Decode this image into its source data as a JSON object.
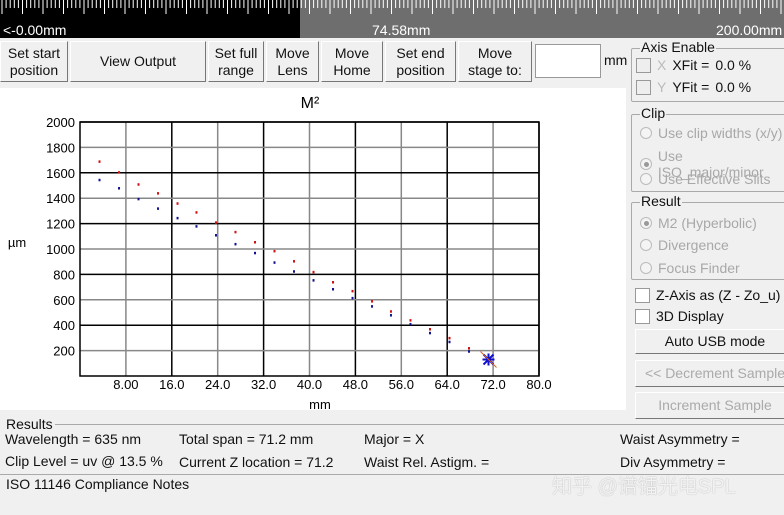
{
  "ruler": {
    "left": "<-0.00mm",
    "current": "74.58mm",
    "right": "200.00mm"
  },
  "toolbar": {
    "set_start": "Set start position",
    "view_output": "View Output",
    "set_full": "Set full range",
    "move_lens": "Move Lens",
    "move_home": "Move Home",
    "set_end": "Set end position",
    "move_stage": "Move stage to:",
    "stage_value": "",
    "unit": "mm"
  },
  "axis_enable": {
    "title": "Axis Enable",
    "x_label": "X",
    "xfit_label": "XFit =",
    "xfit": "0.0 %",
    "y_label": "Y",
    "yfit_label": "YFit =",
    "yfit": "0.0 %"
  },
  "clip": {
    "title": "Clip",
    "options": [
      "Use clip widths (x/y)",
      "Use ISO_major/minor",
      "Use Effective Slits"
    ],
    "selected": 1
  },
  "result": {
    "title": "Result",
    "options": [
      "M2 (Hyperbolic)",
      "Divergence",
      "Focus Finder"
    ],
    "selected": 0
  },
  "checks": {
    "zaxis": "Z-Axis as (Z - Zo_u)",
    "display3d": "3D Display"
  },
  "buttons": {
    "auto_usb": "Auto USB mode",
    "decrement": "<< Decrement Sample",
    "increment": "Increment Sample"
  },
  "results": {
    "title": "Results",
    "wavelength": "Wavelength = 635 nm",
    "clip_level": "Clip Level = uv @ 13.5 %",
    "total_span": "Total span = 71.2 mm",
    "current_z": "Current Z location  = 71.2",
    "major": "Major = X",
    "waist_rel": "Waist Rel. Astigm. =",
    "waist_asym": "Waist Asymmetry =",
    "div_asym": "Div Asymmetry ="
  },
  "iso_notes": "ISO 11146 Compliance Notes",
  "watermark": "知乎 @谱镭光电SPL",
  "chart_data": {
    "type": "scatter",
    "title": "M²",
    "xlabel": "mm",
    "ylabel": "µm",
    "xlim": [
      0,
      80
    ],
    "ylim": [
      0,
      2000
    ],
    "xticks": [
      "8.00",
      "16.0",
      "24.0",
      "32.0",
      "40.0",
      "48.0",
      "56.0",
      "64.0",
      "72.0",
      "80.0"
    ],
    "yticks": [
      "2000",
      "1800",
      "1600",
      "1400",
      "1200",
      "1000",
      "800",
      "600",
      "400",
      "200"
    ],
    "x": [
      3.4,
      6.8,
      10.2,
      13.6,
      17,
      20.3,
      23.7,
      27.1,
      30.5,
      33.9,
      37.3,
      40.7,
      44.1,
      47.5,
      50.9,
      54.2,
      57.6,
      61,
      64.4,
      67.8,
      71.2
    ],
    "series": [
      {
        "name": "X",
        "color": "#d01010",
        "values": [
          1690,
          1605,
          1510,
          1440,
          1360,
          1290,
          1210,
          1135,
          1055,
          985,
          905,
          820,
          740,
          670,
          590,
          510,
          440,
          370,
          300,
          220,
          140
        ]
      },
      {
        "name": "Y",
        "color": "#101090",
        "values": [
          1545,
          1480,
          1395,
          1320,
          1245,
          1180,
          1110,
          1040,
          970,
          895,
          825,
          755,
          685,
          615,
          550,
          480,
          410,
          340,
          270,
          195,
          125
        ]
      }
    ],
    "current_marker": {
      "x": 71.2,
      "y": 130
    }
  }
}
